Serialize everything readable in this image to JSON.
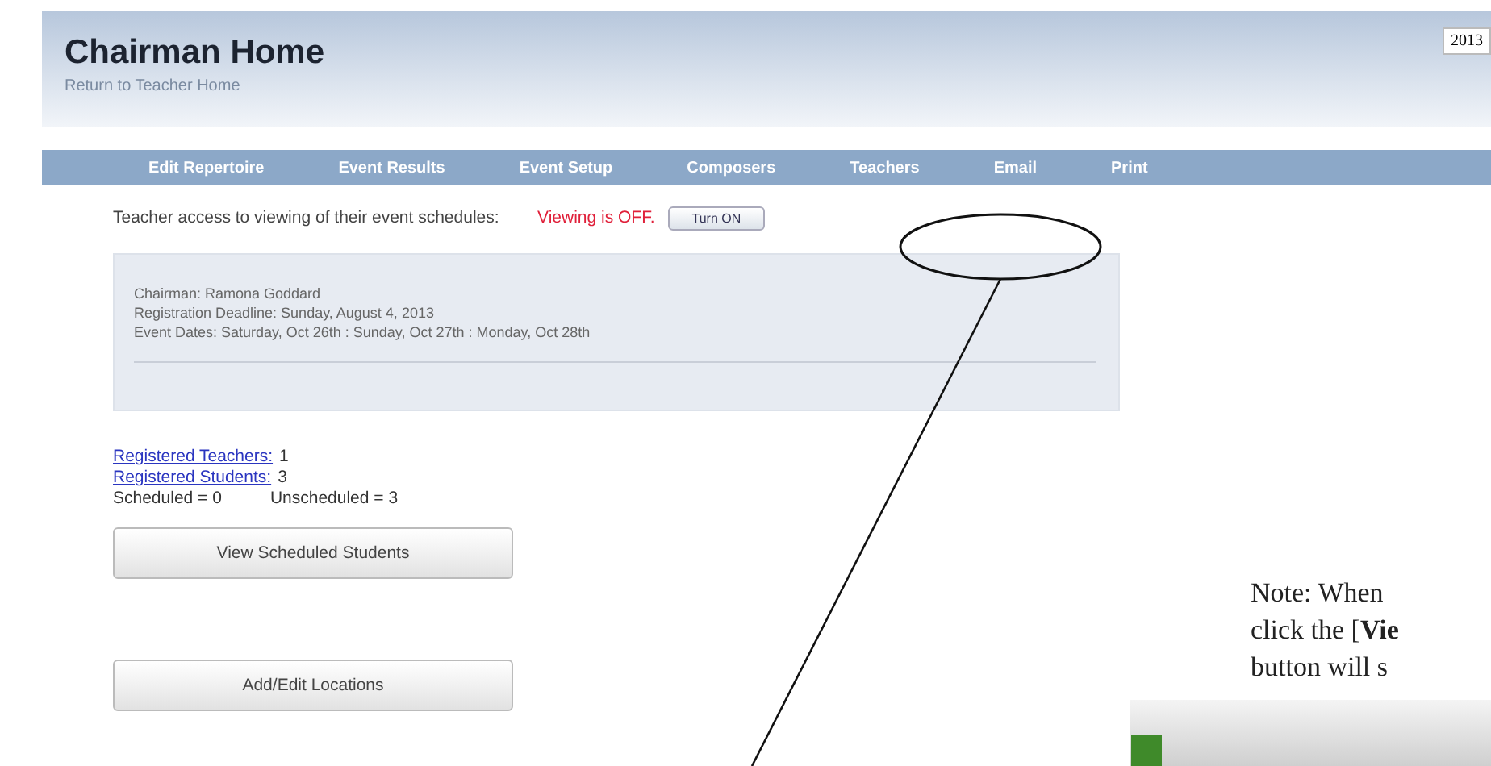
{
  "header": {
    "title": "Chairman Home",
    "link": "Return to Teacher Home",
    "year": "2013"
  },
  "nav": [
    "Edit Repertoire",
    "Event Results",
    "Event Setup",
    "Composers",
    "Teachers",
    "Email",
    "Print"
  ],
  "access": {
    "label": "Teacher access to viewing of their event schedules:",
    "status": "Viewing is OFF.",
    "button": "Turn ON"
  },
  "info": [
    "Chairman: Ramona Goddard",
    "Registration Deadline: Sunday, August 4, 2013",
    "Event Dates: Saturday, Oct 26th : Sunday, Oct 27th : Monday, Oct 28th"
  ],
  "counts": [
    {
      "link": "Registered Teachers:",
      "value": "1"
    },
    {
      "link": "Registered Students:",
      "value": "3"
    }
  ],
  "schedule": [
    "Scheduled = 0",
    "Unscheduled = 3"
  ],
  "buttons": [
    "View Scheduled Students",
    "Add/Edit Locations"
  ],
  "note": [
    "Note: When",
    "click the [**Vie**",
    "button will s"
  ]
}
